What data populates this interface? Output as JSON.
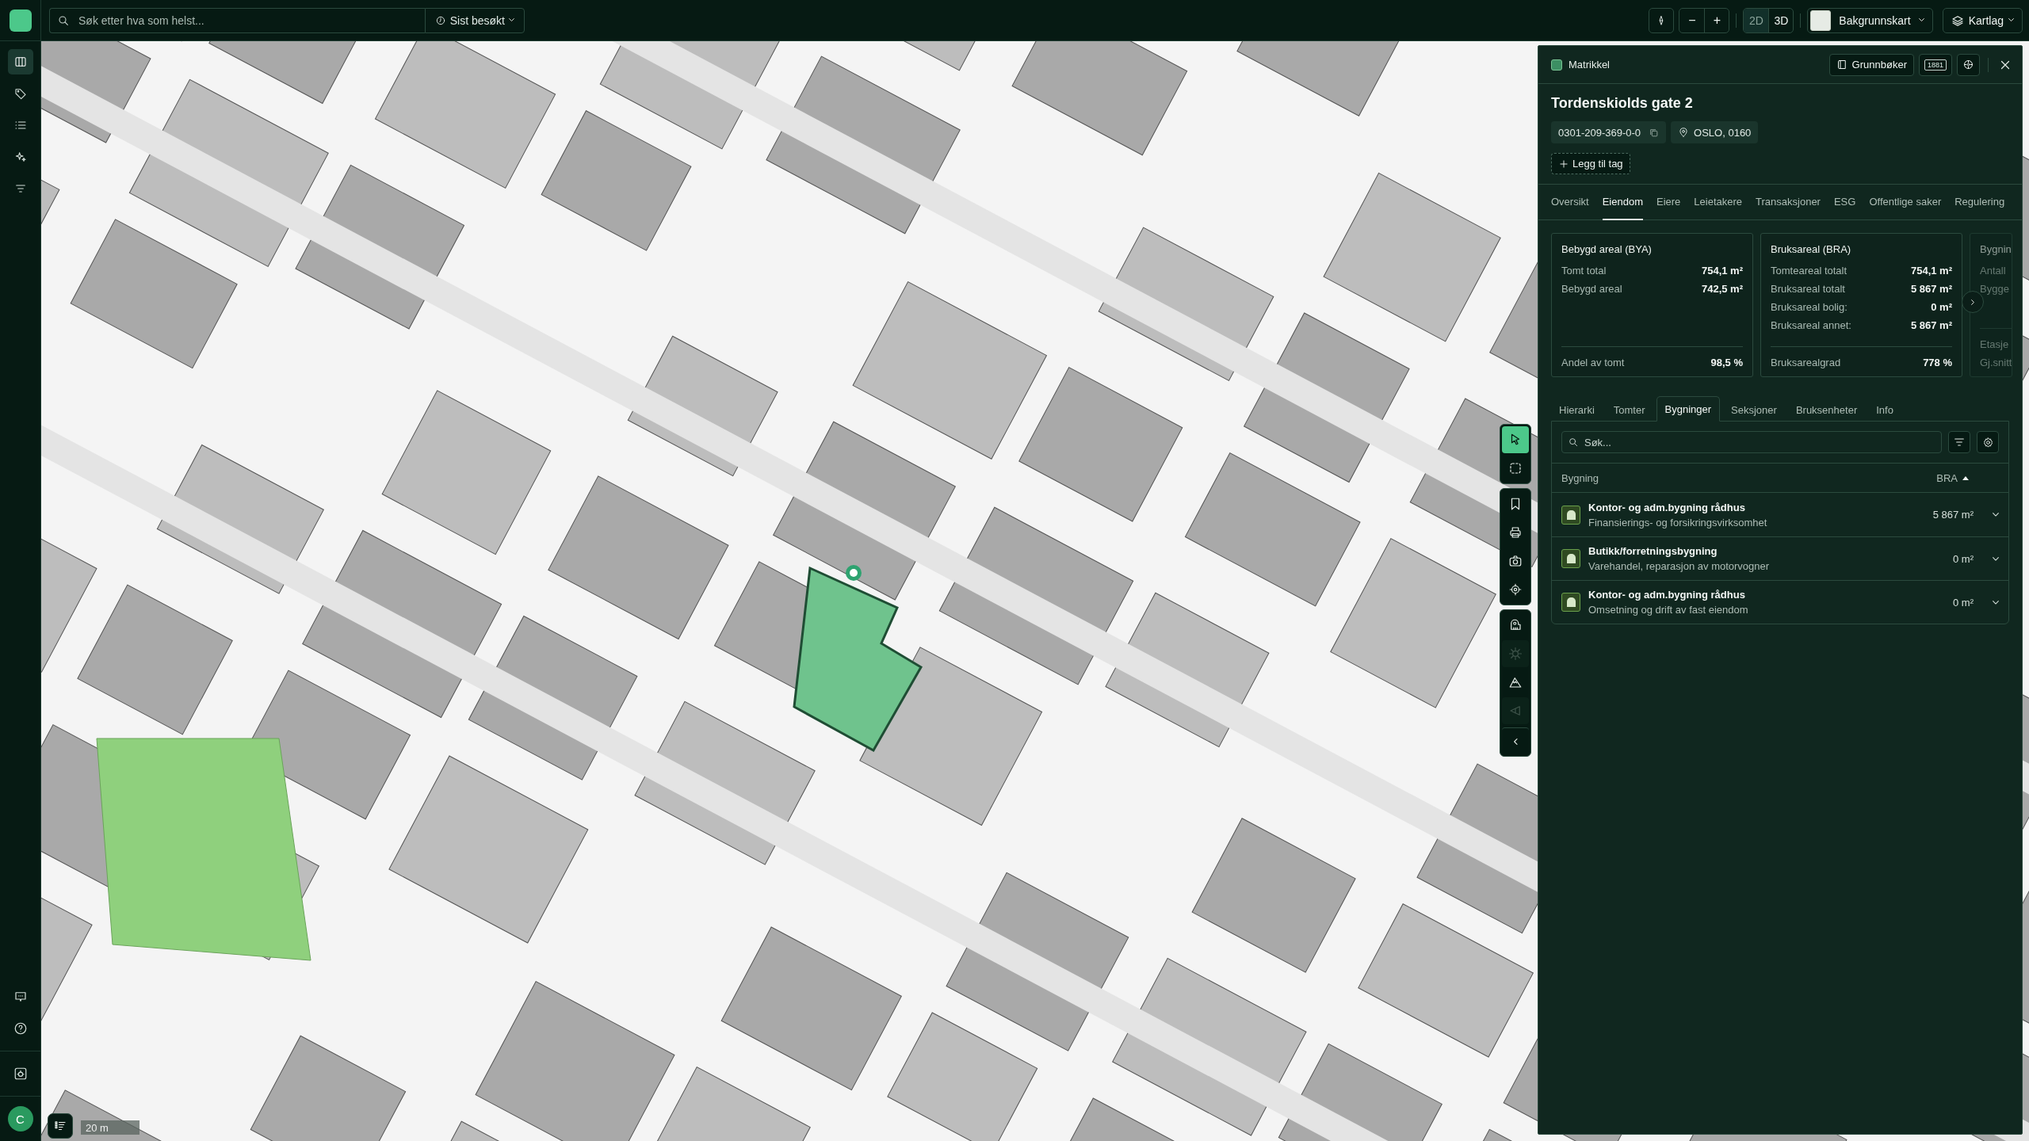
{
  "top_bar": {
    "search": {
      "placeholder": "Søk etter hva som helst..."
    },
    "recent_button": "Sist besøkt",
    "zoom_out": "−",
    "zoom_in": "+",
    "view_modes": [
      {
        "label": "2D",
        "selected": true
      },
      {
        "label": "3D",
        "selected": false
      }
    ],
    "basemap_button": "Bakgrunnskart",
    "layers_button": "Kartlag"
  },
  "sidebar": {
    "items": [
      {
        "kind": "map",
        "selected": true
      },
      {
        "kind": "tag",
        "selected": false
      },
      {
        "kind": "list",
        "selected": false
      },
      {
        "kind": "sparkle",
        "selected": false
      },
      {
        "kind": "filter",
        "selected": false
      }
    ],
    "bottom_items": [
      {
        "kind": "chat"
      },
      {
        "kind": "help"
      },
      {
        "kind": "plugin"
      }
    ],
    "avatar": "C"
  },
  "map": {
    "scale": "20 m",
    "tool_groups": [
      [
        {
          "kind": "pointer",
          "selected": true,
          "disabled": false
        },
        {
          "kind": "box-select",
          "selected": false,
          "disabled": false
        }
      ],
      [
        {
          "kind": "bookmark",
          "selected": false,
          "disabled": false
        },
        {
          "kind": "printer",
          "selected": false,
          "disabled": false
        },
        {
          "kind": "camera",
          "selected": false,
          "disabled": false
        },
        {
          "kind": "target",
          "selected": false,
          "disabled": false
        }
      ],
      [
        {
          "kind": "tape",
          "selected": false,
          "disabled": false
        },
        {
          "kind": "sun",
          "selected": false,
          "disabled": true
        },
        {
          "kind": "mountain",
          "selected": false,
          "disabled": false
        },
        {
          "kind": "viewshed",
          "selected": false,
          "disabled": true
        }
      ]
    ]
  },
  "panel": {
    "source": "Matrikkel",
    "grunnboker_button": "Grunnbøker",
    "directory_button": "1881",
    "title": "Tordenskiolds gate 2",
    "property_id": "0301-209-369-0-0",
    "location": "OSLO, 0160",
    "add_tag": "Legg til tag",
    "tabs": [
      {
        "label": "Oversikt",
        "selected": false
      },
      {
        "label": "Eiendom",
        "selected": true
      },
      {
        "label": "Eiere",
        "selected": false
      },
      {
        "label": "Leietakere",
        "selected": false
      },
      {
        "label": "Transaksjoner",
        "selected": false
      },
      {
        "label": "ESG",
        "selected": false
      },
      {
        "label": "Offentlige saker",
        "selected": false
      },
      {
        "label": "Regulering",
        "selected": false
      }
    ],
    "cards": [
      {
        "title": "Bebygd areal (BYA)",
        "rows": [
          {
            "label": "Tomt total",
            "value": "754,1 m²"
          },
          {
            "label": "Bebygd areal",
            "value": "742,5 m²"
          }
        ],
        "summary": [
          {
            "label": "Andel av tomt",
            "value": "98,5 %"
          }
        ]
      },
      {
        "title": "Bruksareal (BRA)",
        "rows": [
          {
            "label": "Tomteareal totalt",
            "value": "754,1 m²"
          },
          {
            "label": "Bruksareal totalt",
            "value": "5 867 m²"
          },
          {
            "label": "Bruksareal bolig:",
            "value": "0 m²"
          },
          {
            "label": "Bruksareal annet:",
            "value": "5 867 m²"
          }
        ],
        "summary": [
          {
            "label": "Bruksarealgrad",
            "value": "778 %"
          }
        ]
      },
      {
        "title": "Bygnin",
        "rows": [
          {
            "label": "Antall"
          },
          {
            "label": "Bygge"
          }
        ],
        "summary": [
          {
            "label": "Etasje"
          },
          {
            "label": "Gj.snitt"
          }
        ]
      }
    ],
    "sub_tabs": [
      {
        "label": "Hierarki",
        "selected": false
      },
      {
        "label": "Tomter",
        "selected": false
      },
      {
        "label": "Bygninger",
        "selected": true
      },
      {
        "label": "Seksjoner",
        "selected": false
      },
      {
        "label": "Bruksenheter",
        "selected": false
      },
      {
        "label": "Info",
        "selected": false
      }
    ],
    "buildings": {
      "search": {
        "placeholder": "Søk..."
      },
      "columns": [
        {
          "label": "Bygning"
        },
        {
          "label": "BRA",
          "sorted": true
        }
      ],
      "rows": [
        {
          "name": "Kontor- og adm.bygning rådhus",
          "category": "Finansierings- og forsikringsvirksomhet",
          "bra": "5 867 m²"
        },
        {
          "name": "Butikk/forretningsbygning",
          "category": "Varehandel, reparasjon av motorvogner",
          "bra": "0 m²"
        },
        {
          "name": "Kontor- og adm.bygning rådhus",
          "category": "Omsetning og drift av fast eiendom",
          "bra": "0 m²"
        }
      ]
    }
  }
}
